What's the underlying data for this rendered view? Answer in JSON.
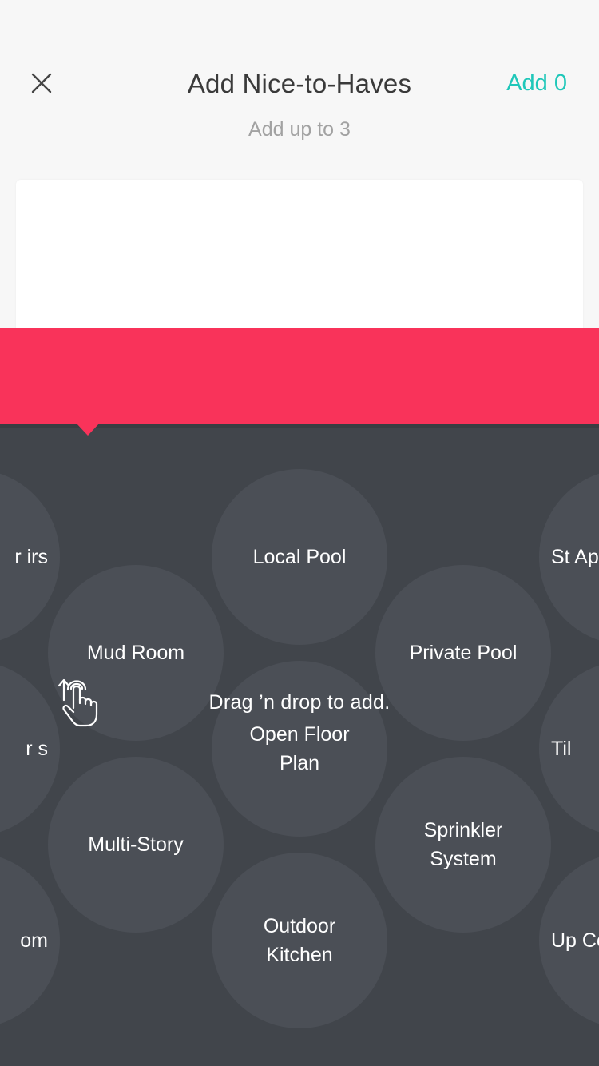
{
  "header": {
    "title": "Add Nice-to-Haves",
    "subtitle": "Add up to 3",
    "add_label": "Add 0",
    "close_icon": "close-icon"
  },
  "banner": {
    "text": "Drag ’n drop to add.",
    "icon": "hand-drag-icon",
    "color": "#f9335a"
  },
  "colors": {
    "accent": "#1fc7b9",
    "bubble": "#4b4f56",
    "panel": "#41454b"
  },
  "bubbles": [
    {
      "label": "Local Pool"
    },
    {
      "label": "Mud Room"
    },
    {
      "label": "Private Pool"
    },
    {
      "label": "Open Floor Plan"
    },
    {
      "label": "Multi-Story"
    },
    {
      "label": "Sprinkler System"
    },
    {
      "label": "Outdoor Kitchen"
    },
    {
      "label": "r irs"
    },
    {
      "label": "r s"
    },
    {
      "label": "om"
    },
    {
      "label": "St Ap"
    },
    {
      "label": "Til"
    },
    {
      "label": "Up Cou"
    }
  ]
}
